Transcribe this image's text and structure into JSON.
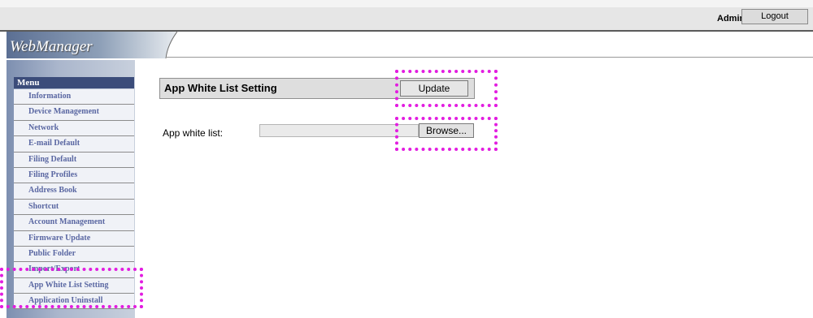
{
  "topbar": {
    "user": "Admin",
    "logout_label": "Logout"
  },
  "header": {
    "logo_text": "WebManager"
  },
  "sidebar": {
    "menu_title": "Menu",
    "items": [
      {
        "label": "Information"
      },
      {
        "label": "Device Management"
      },
      {
        "label": "Network"
      },
      {
        "label": "E-mail Default"
      },
      {
        "label": "Filing Default"
      },
      {
        "label": "Filing Profiles"
      },
      {
        "label": "Address Book"
      },
      {
        "label": "Shortcut"
      },
      {
        "label": "Account Management"
      },
      {
        "label": "Firmware Update"
      },
      {
        "label": "Public Folder"
      },
      {
        "label": "Import/Export"
      },
      {
        "label": "App White List Setting"
      },
      {
        "label": "Application Uninstall"
      }
    ],
    "active_item": "App White List Setting"
  },
  "main": {
    "title": "App White List Setting",
    "update_label": "Update",
    "field_label": "App white list:",
    "file_value": "",
    "browse_label": "Browse..."
  },
  "colors": {
    "highlight": "#e21de0",
    "menu_header": "#3b4c7a",
    "menu_text": "#5a67a2"
  }
}
